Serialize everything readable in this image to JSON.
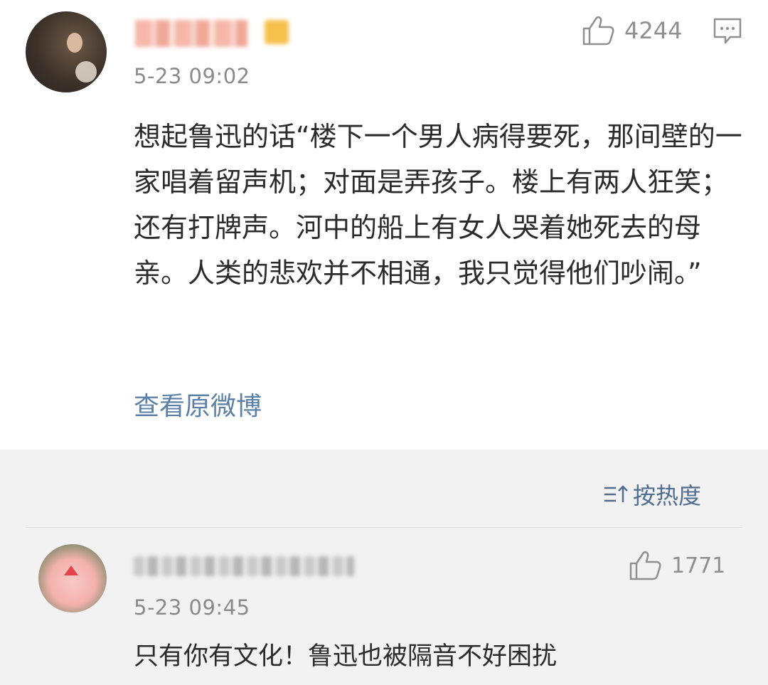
{
  "post": {
    "time": "5-23 09:02",
    "like_count": "4244",
    "body": "想起鲁迅的话“楼下一个男人病得要死，那间壁的一家唱着留声机；对面是弄孩子。楼上有两人狂笑；还有打牌声。河中的船上有女人哭着她死去的母亲。人类的悲欢并不相通，我只觉得他们吵闹。”",
    "view_original": "查看原微博"
  },
  "comments_section": {
    "sort_label": "按热度"
  },
  "comment": {
    "time": "5-23 09:45",
    "like_count": "1771",
    "text": "只有你有文化！鲁迅也被隔音不好困扰"
  },
  "icons": {
    "like": "thumbs-up-icon",
    "comment": "comment-icon",
    "sort": "sort-icon"
  },
  "colors": {
    "link": "#5b7fa6",
    "sort": "#4f6d8f",
    "meta": "#8a8a8a"
  }
}
